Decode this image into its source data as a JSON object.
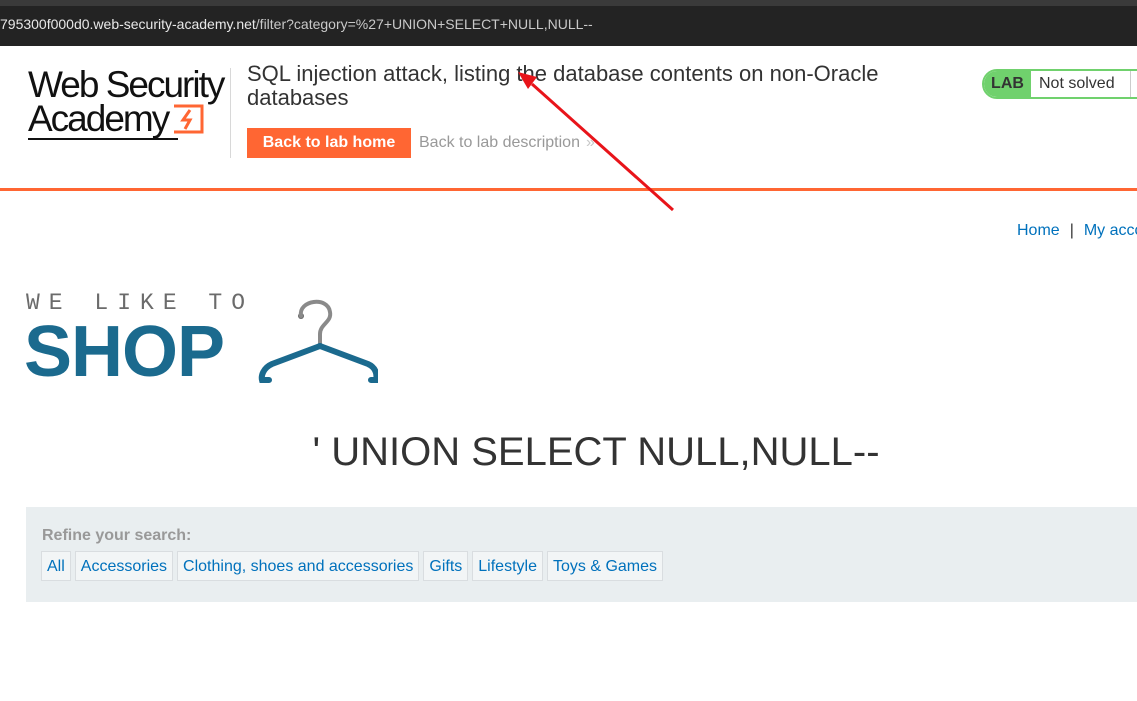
{
  "browser": {
    "url_prefix": "795300f000d0.web-security-academy.net",
    "url_rest": "/filter?category=%27+UNION+SELECT+NULL,NULL--"
  },
  "header": {
    "logo_line1": "Web Security",
    "logo_line2": "Academy",
    "lab_title": "SQL injection attack, listing the database contents on non-Oracle databases",
    "back_home_label": "Back to lab home",
    "back_description_label": "Back to lab description",
    "lab_badge_label": "LAB",
    "lab_status": "Not solved"
  },
  "nav": {
    "home_label": "Home",
    "separator": "|",
    "account_label": "My acco"
  },
  "shop_logo": {
    "tagline": "WE LIKE TO",
    "name": "SHOP"
  },
  "main": {
    "heading": "' UNION SELECT NULL,NULL--"
  },
  "filters": {
    "refine_label": "Refine your search:",
    "categories": [
      "All",
      "Accessories",
      "Clothing, shoes and accessories",
      "Gifts",
      "Lifestyle",
      "Toys & Games"
    ]
  },
  "colors": {
    "accent_orange": "#ff6633",
    "link_blue": "#0071bc",
    "lab_green": "#70d16d",
    "shop_blue": "#1b6a8e",
    "annotation_red": "#e8141a"
  }
}
